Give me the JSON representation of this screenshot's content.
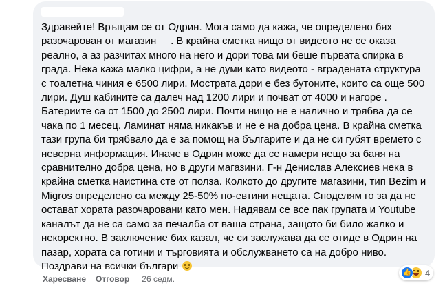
{
  "comment": {
    "text": "Здравейте! Връщам се от Одрин. Мога само да кажа, че определено бях разочарован от магазин     . В крайна сметка нищо от видеото не се оказа реално, а аз разчитах много на него и дори това ми беше първата спирка в града. Нека кажа малко цифри, а не думи като видеото - вградената структура с тоалетна чиния е 6500 лири. Мострата дори е без бутоните, които са още 500 лири. Душ кабините са далеч над 1200 лири и почват от 4000 и нагоре . Батериите са от 1500 до 2500 лири. Почти нищо не е налично и трябва да се чака по 1 месец. Ламинат няма никакъв и не е на добра цена. В крайна сметка тази група би трябвало да е за помощ на българите и да не си губят времето с неверна информация. Иначе в Одрин може да се намери нещо за баня на сравнително добра цена, но в други магазини. Г-н Денислав Алексиев нека в крайна сметка наистина сте от полза. Колкото до другите магазини, тип Bezim и Migros определено са между 25-50% по-евтини нещата. Споделям го за да не остават хората разочаровани като мен. Надявам се все пак групата и Youtube каналът да не са само за печалба от ваша страна, защото би било жалко и некоректно. В заключение бих казал, че си заслужава да се отиде в Одрин на пазар, хората са готини и търговията и обслужването са на добро ниво. Поздрави на всички българи "
  },
  "reactions": {
    "icons": [
      "like-icon",
      "haha-icon"
    ],
    "count": "4"
  },
  "actions": {
    "like_label": "Харесване",
    "reply_label": "Отговор",
    "time": "26 седм."
  },
  "colors": {
    "bubble": "#f0f2f5",
    "text": "#050505",
    "meta": "#65676b",
    "like": "#1877f2"
  }
}
